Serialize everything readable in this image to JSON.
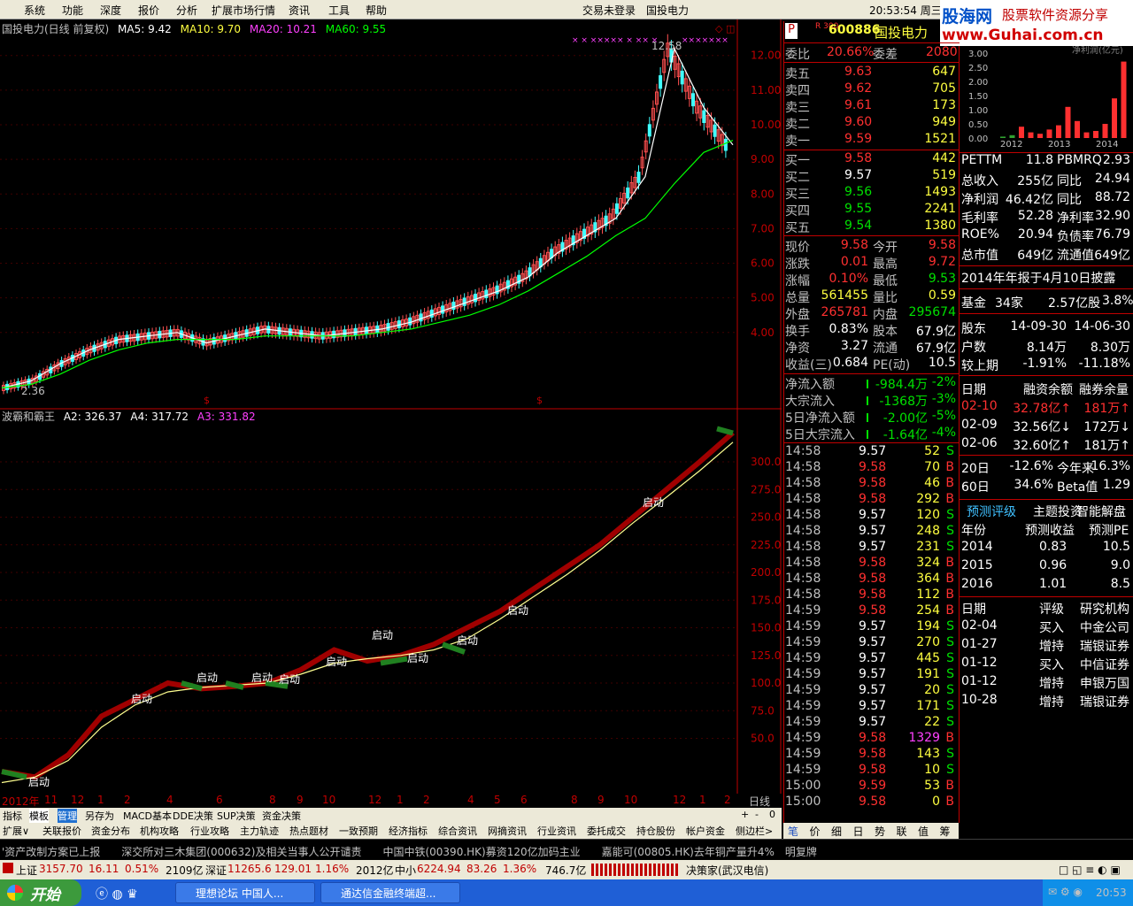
{
  "menu": {
    "items": [
      "系统",
      "功能",
      "深度",
      "报价",
      "分析",
      "扩展市场行情",
      "资讯",
      "工具",
      "帮助"
    ],
    "right_items": [
      "交易未登录",
      "国投电力"
    ],
    "clock": "20:53:54 周三"
  },
  "brand": {
    "name": "股海网",
    "tagline": "股票软件资源分享",
    "url": "www.Guhai.com.cn"
  },
  "chart": {
    "title": "国投电力(日线 前复权)",
    "ma": [
      {
        "label": "MA5: 9.42",
        "color": "#ffffff"
      },
      {
        "label": "MA10: 9.70",
        "color": "#ffff40"
      },
      {
        "label": "MA20: 10.21",
        "color": "#ff40ff"
      },
      {
        "label": "MA60: 9.55",
        "color": "#00ff00"
      }
    ],
    "high_label": "12.58",
    "low_label": "2.36",
    "period": "日线",
    "x_labels": [
      "2012年",
      "11",
      "12",
      "1",
      "2",
      "4",
      "6",
      "8",
      "9",
      "10",
      "12",
      "1",
      "2",
      "4",
      "5",
      "6",
      "8",
      "9",
      "10",
      "12",
      "1",
      "2"
    ]
  },
  "chart_data": [
    {
      "type": "line",
      "title": "国投电力(日线 前复权)",
      "ylim": [
        2.36,
        12.58
      ],
      "y_ticks": [
        "12.00",
        "11.00",
        "10.00",
        "9.00",
        "8.00",
        "7.00",
        "6.00",
        "5.00",
        "4.00"
      ],
      "series": [
        {
          "name": "MA5",
          "values": [
            2.4,
            2.6,
            3.1,
            3.5,
            3.8,
            3.9,
            4.0,
            3.7,
            3.9,
            4.1,
            4.0,
            3.9,
            4.0,
            4.1,
            4.3,
            4.6,
            4.9,
            5.2,
            5.6,
            6.3,
            6.8,
            7.3,
            8.5,
            12.2,
            10.5,
            9.42
          ]
        },
        {
          "name": "MA60",
          "values": [
            2.4,
            2.5,
            2.8,
            3.2,
            3.5,
            3.7,
            3.8,
            3.8,
            3.8,
            3.9,
            3.9,
            3.9,
            3.9,
            4.0,
            4.1,
            4.3,
            4.5,
            4.8,
            5.2,
            5.7,
            6.2,
            6.8,
            7.3,
            8.3,
            9.2,
            9.55
          ]
        }
      ]
    },
    {
      "type": "line",
      "title": "波霸和霸王",
      "ylim": [
        0,
        340
      ],
      "y_ticks": [
        "300.0",
        "275.0",
        "250.0",
        "225.0",
        "200.0",
        "175.0",
        "150.0",
        "125.0",
        "100.0",
        "75.0",
        "50.0"
      ],
      "series": [
        {
          "name": "A2: 326.37",
          "values": [
            20,
            15,
            35,
            70,
            85,
            100,
            95,
            97,
            100,
            112,
            130,
            120,
            125,
            135,
            150,
            165,
            185,
            205,
            225,
            250,
            275,
            300,
            326.37
          ]
        },
        {
          "name": "A4: 317.72",
          "values": [
            10,
            15,
            30,
            60,
            80,
            92,
            96,
            98,
            100,
            108,
            118,
            122,
            125,
            130,
            140,
            158,
            178,
            198,
            220,
            245,
            268,
            292,
            317.72
          ]
        },
        {
          "name": "A3: 331.82",
          "values": [
            20,
            15,
            35,
            70,
            85,
            100,
            95,
            97,
            100,
            112,
            130,
            120,
            125,
            135,
            150,
            165,
            185,
            205,
            225,
            250,
            275,
            300,
            331.82
          ]
        }
      ],
      "annotations": [
        "启动",
        "启动",
        "启动",
        "启动",
        "启动",
        "启动",
        "启动",
        "启动",
        "启动",
        "启动",
        "启动"
      ]
    }
  ],
  "indicator": {
    "name": "波霸和霸王",
    "labels": [
      {
        "label": "A2: 326.37",
        "color": "#ffffff"
      },
      {
        "label": "A4: 317.72",
        "color": "#ffffff"
      },
      {
        "label": "A3: 331.82",
        "color": "#ff40ff"
      }
    ]
  },
  "tabs1": [
    "指标",
    "模板",
    "管理",
    "另存为",
    "MACD基本",
    "DDE决策",
    "SUP决策",
    "资金决策"
  ],
  "tabs1_right": [
    "+",
    "-",
    "0"
  ],
  "tabs2": [
    "扩展∨",
    "关联报价",
    "资金分布",
    "机构攻略",
    "行业攻略",
    "主力轨迹",
    "热点题材",
    "一致预期",
    "经济指标",
    "综合资讯",
    "网摘资讯",
    "行业资讯",
    "委托成交",
    "持仓股份",
    "帐户资金",
    "侧边栏>"
  ],
  "quote": {
    "code": "600886",
    "name": "国投电力",
    "badge": "R 300",
    "weibi_label": "委比",
    "weibi": "20.66%",
    "weicha_label": "委差",
    "weicha": "2080",
    "asks": [
      {
        "label": "卖五",
        "price": "9.63",
        "vol": "647"
      },
      {
        "label": "卖四",
        "price": "9.62",
        "vol": "705"
      },
      {
        "label": "卖三",
        "price": "9.61",
        "vol": "173"
      },
      {
        "label": "卖二",
        "price": "9.60",
        "vol": "949"
      },
      {
        "label": "卖一",
        "price": "9.59",
        "vol": "1521"
      }
    ],
    "bids": [
      {
        "label": "买一",
        "price": "9.58",
        "vol": "442"
      },
      {
        "label": "买二",
        "price": "9.57",
        "vol": "519"
      },
      {
        "label": "买三",
        "price": "9.56",
        "vol": "1493"
      },
      {
        "label": "买四",
        "price": "9.55",
        "vol": "2241"
      },
      {
        "label": "买五",
        "price": "9.54",
        "vol": "1380"
      }
    ],
    "stats": [
      {
        "l1": "现价",
        "v1": "9.58",
        "l2": "今开",
        "v2": "9.58"
      },
      {
        "l1": "涨跌",
        "v1": "0.01",
        "l2": "最高",
        "v2": "9.72"
      },
      {
        "l1": "涨幅",
        "v1": "0.10%",
        "l2": "最低",
        "v2": "9.53"
      },
      {
        "l1": "总量",
        "v1": "561455",
        "l2": "量比",
        "v2": "0.59"
      },
      {
        "l1": "外盘",
        "v1": "265781",
        "l2": "内盘",
        "v2": "295674"
      },
      {
        "l1": "换手",
        "v1": "0.83%",
        "l2": "股本",
        "v2": "67.9亿"
      },
      {
        "l1": "净资",
        "v1": "3.27",
        "l2": "流通",
        "v2": "67.9亿"
      },
      {
        "l1": "收益(三)",
        "v1": "0.684",
        "l2": "PE(动)",
        "v2": "10.5"
      }
    ],
    "flows": [
      {
        "label": "净流入额",
        "value": "-984.4万",
        "pct": "-2%"
      },
      {
        "label": "大宗流入",
        "value": "-1368万",
        "pct": "-3%"
      },
      {
        "label": "5日净流入额",
        "value": "-2.00亿",
        "pct": "-5%"
      },
      {
        "label": "5日大宗流入",
        "value": "-1.64亿",
        "pct": "-4%"
      }
    ],
    "ticks": [
      {
        "t": "14:58",
        "p": "9.57",
        "v": "52",
        "s": "S"
      },
      {
        "t": "14:58",
        "p": "9.58",
        "v": "70",
        "s": "B"
      },
      {
        "t": "14:58",
        "p": "9.58",
        "v": "46",
        "s": "B"
      },
      {
        "t": "14:58",
        "p": "9.58",
        "v": "292",
        "s": "B"
      },
      {
        "t": "14:58",
        "p": "9.57",
        "v": "120",
        "s": "S"
      },
      {
        "t": "14:58",
        "p": "9.57",
        "v": "248",
        "s": "S"
      },
      {
        "t": "14:58",
        "p": "9.57",
        "v": "231",
        "s": "S"
      },
      {
        "t": "14:58",
        "p": "9.58",
        "v": "324",
        "s": "B"
      },
      {
        "t": "14:58",
        "p": "9.58",
        "v": "364",
        "s": "B"
      },
      {
        "t": "14:58",
        "p": "9.58",
        "v": "112",
        "s": "B"
      },
      {
        "t": "14:59",
        "p": "9.58",
        "v": "254",
        "s": "B"
      },
      {
        "t": "14:59",
        "p": "9.57",
        "v": "194",
        "s": "S"
      },
      {
        "t": "14:59",
        "p": "9.57",
        "v": "270",
        "s": "S"
      },
      {
        "t": "14:59",
        "p": "9.57",
        "v": "445",
        "s": "S"
      },
      {
        "t": "14:59",
        "p": "9.57",
        "v": "191",
        "s": "S"
      },
      {
        "t": "14:59",
        "p": "9.57",
        "v": "20",
        "s": "S"
      },
      {
        "t": "14:59",
        "p": "9.57",
        "v": "171",
        "s": "S"
      },
      {
        "t": "14:59",
        "p": "9.57",
        "v": "22",
        "s": "S"
      },
      {
        "t": "14:59",
        "p": "9.58",
        "v": "1329",
        "s": "B"
      },
      {
        "t": "14:59",
        "p": "9.58",
        "v": "143",
        "s": "S"
      },
      {
        "t": "14:59",
        "p": "9.58",
        "v": "10",
        "s": "S"
      },
      {
        "t": "15:00",
        "p": "9.59",
        "v": "53",
        "s": "B"
      },
      {
        "t": "15:00",
        "p": "9.58",
        "v": "0",
        "s": "B"
      }
    ],
    "bottom_tabs": [
      "笔",
      "价",
      "细",
      "日",
      "势",
      "联",
      "值",
      "筹"
    ]
  },
  "f10": {
    "bar_chart_caption": "净利润(亿元)",
    "bar_ylabels": [
      "3.00",
      "2.50",
      "2.00",
      "1.50",
      "1.00",
      "0.50",
      "0.00"
    ],
    "bar_xlabels": [
      "2012",
      "2013",
      "2014"
    ],
    "bar_values": [
      0.05,
      0.1,
      0.4,
      0.2,
      0.15,
      0.3,
      0.45,
      1.1,
      0.6,
      0.2,
      0.25,
      0.5,
      1.4,
      2.7
    ],
    "metrics": [
      {
        "l1": "PETTM",
        "v1": "11.8",
        "l2": "PBMRQ",
        "v2": "2.93"
      },
      {
        "l1": "总收入",
        "v1": "255亿",
        "l2": "同比",
        "v2": "24.94"
      },
      {
        "l1": "净利润",
        "v1": "46.42亿",
        "l2": "同比",
        "v2": "88.72"
      },
      {
        "l1": "毛利率",
        "v1": "52.28",
        "l2": "净利率",
        "v2": "32.90"
      },
      {
        "l1": "ROE%",
        "v1": "20.94",
        "l2": "负债率",
        "v2": "76.79"
      },
      {
        "l1": "总市值",
        "v1": "649亿",
        "l2": "流通值",
        "v2": "649亿"
      }
    ],
    "report_note": "2014年年报于4月10日披露",
    "fund": {
      "label": "基金",
      "count": "34家",
      "shares": "2.57亿股",
      "pct": "3.8%"
    },
    "holders": [
      {
        "l": "股东",
        "a": "14-09-30",
        "b": "14-06-30"
      },
      {
        "l": "户数",
        "a": "8.14万",
        "b": "8.30万"
      },
      {
        "l": "较上期",
        "a": "-1.91%",
        "b": "-11.18%"
      }
    ],
    "margin_header": {
      "date": "日期",
      "rz": "融资余额",
      "rq": "融券余量"
    },
    "margin": [
      {
        "d": "02-10",
        "rz": "32.78亿↑",
        "rq": "181万↑"
      },
      {
        "d": "02-09",
        "rz": "32.56亿↓",
        "rq": "172万↓"
      },
      {
        "d": "02-06",
        "rz": "32.60亿↑",
        "rq": "181万↑"
      }
    ],
    "perf": [
      {
        "l1": "20日",
        "v1": "-12.6%",
        "l2": "今年来",
        "v2": "-16.3%"
      },
      {
        "l1": "60日",
        "v1": "34.6%",
        "l2": "Beta值",
        "v2": "1.29"
      }
    ],
    "tabs": [
      "预测评级",
      "主题投资",
      "智能解盘"
    ],
    "forecast_header": {
      "y": "年份",
      "e": "预测收益",
      "pe": "预测PE"
    },
    "forecast": [
      {
        "y": "2014",
        "e": "0.83",
        "pe": "10.5"
      },
      {
        "y": "2015",
        "e": "0.96",
        "pe": "9.0"
      },
      {
        "y": "2016",
        "e": "1.01",
        "pe": "8.5"
      }
    ],
    "rating_header": {
      "d": "日期",
      "r": "评级",
      "o": "研究机构"
    },
    "ratings": [
      {
        "d": "02-04",
        "r": "买入",
        "o": "中金公司"
      },
      {
        "d": "01-27",
        "r": "增持",
        "o": "瑞银证券"
      },
      {
        "d": "01-12",
        "r": "买入",
        "o": "中信证券"
      },
      {
        "d": "01-12",
        "r": "增持",
        "o": "申银万国"
      },
      {
        "d": "10-28",
        "r": "增持",
        "o": "瑞银证券"
      }
    ]
  },
  "ticker": "'资产改制方案已上报　　深交所对三木集团(000632)及相关当事人公开谴责　　中国中铁(00390.HK)募资120亿加码主业　　嘉能可(00805.HK)去年铜产量升4%　明复牌",
  "status": {
    "sh_label": "上证",
    "sh": "3157.70",
    "sh_chg": "16.11",
    "sh_pct": "0.51%",
    "sh_amt": "2109亿",
    "sz_label": "深证",
    "sz": "11265.6",
    "sz_chg": "129.01",
    "sz_pct": "1.16%",
    "sz_amt": "2012亿",
    "zx_label": "中小",
    "zx": "6224.94",
    "zx_chg": "83.26",
    "zx_pct": "1.36%",
    "zx_amt": "746.7亿",
    "right": "决策家(武汉电信)"
  },
  "taskbar": {
    "start": "开始",
    "tasks": [
      "理想论坛 中国人...",
      "通达信金融终端超..."
    ],
    "time": "20:53"
  }
}
